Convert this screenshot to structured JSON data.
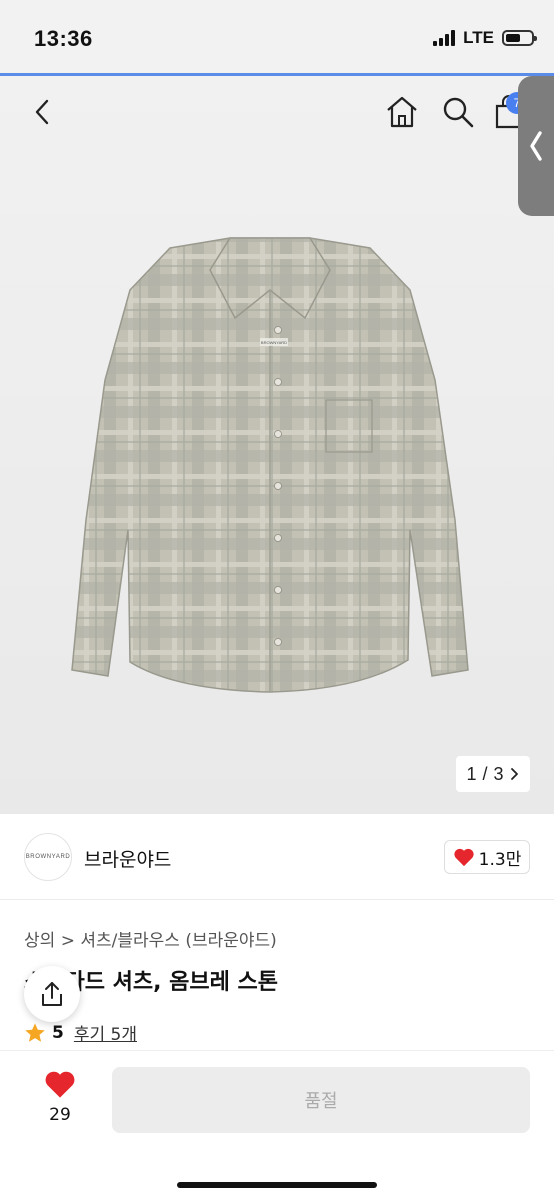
{
  "status": {
    "time": "13:36",
    "network": "LTE"
  },
  "nav": {
    "cart_count": "7"
  },
  "gallery": {
    "current": "1",
    "separator": "/",
    "total": "3",
    "brand_tag": "BROWNYARD"
  },
  "brand": {
    "logo_text": "BROWNYARD",
    "name": "브라운야드",
    "likes": "1.3만"
  },
  "product": {
    "breadcrumb_category": "상의",
    "breadcrumb_sep": ">",
    "breadcrumb_sub": "셔츠/블라우스 (브라운야드)",
    "title": "스탠다드 셔츠, 옴브레 스톤",
    "rating": "5",
    "review_label": "후기 5개"
  },
  "bottom": {
    "wish_count": "29",
    "buy_label": "품절"
  },
  "colors": {
    "accent": "#4a7ff0",
    "heart": "#e5262d",
    "star": "#f5a623"
  }
}
